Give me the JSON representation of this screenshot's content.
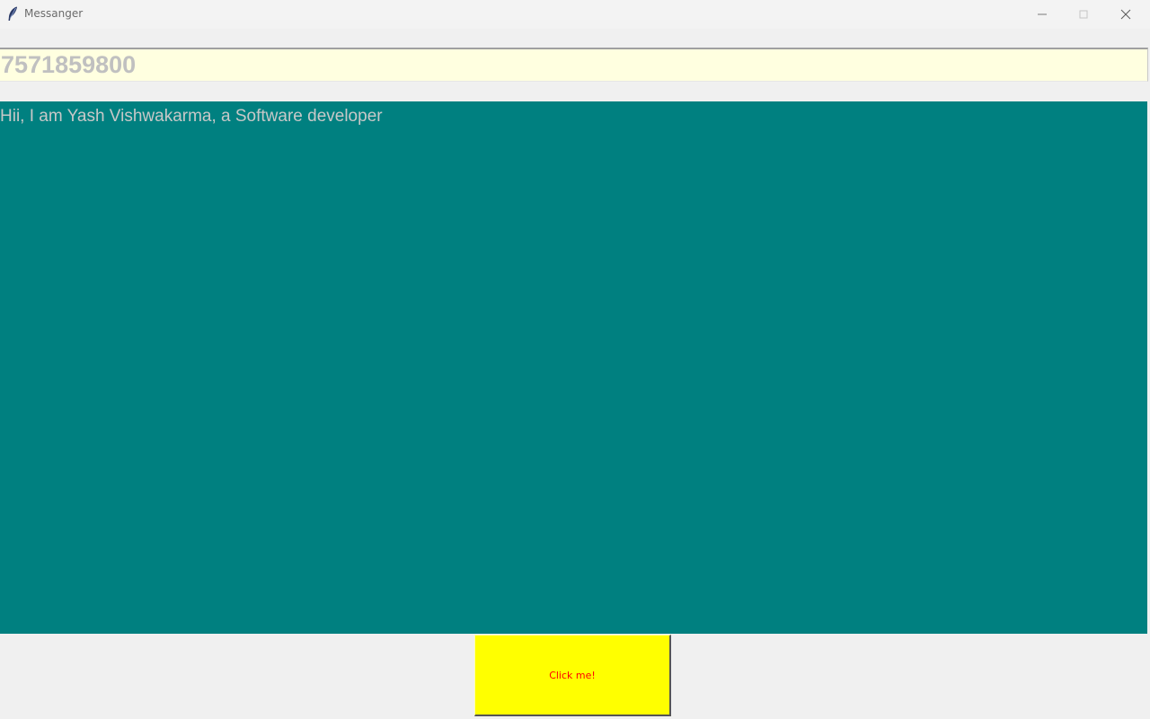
{
  "window": {
    "title": "Messanger",
    "icons": {
      "app": "feather-icon",
      "minimize": "minimize-icon",
      "maximize": "maximize-icon",
      "close": "close-icon"
    }
  },
  "entry": {
    "value": "7571859800",
    "background": "#ffffe0",
    "text_color": "#c0c0c0"
  },
  "message": {
    "text": "Hii, I am Yash Vishwakarma, a Software developer",
    "background": "#008080",
    "text_color": "#c8c8c8"
  },
  "button": {
    "label": "Click me!",
    "background": "#ffff00",
    "text_color": "#ff0000"
  }
}
